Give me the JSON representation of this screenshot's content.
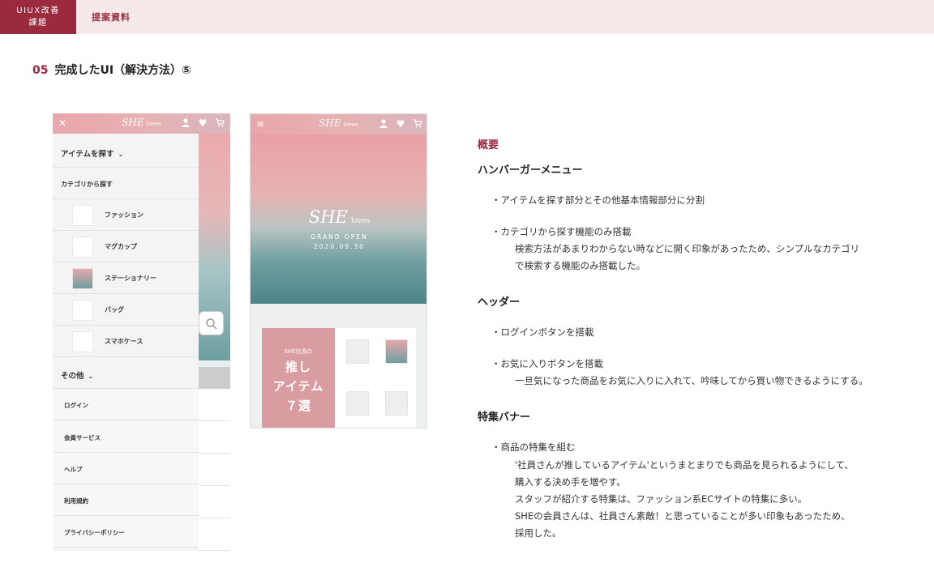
{
  "topbar": {
    "badge_line1": "UIUX改善",
    "badge_line2": "課題",
    "crumb": "提案資料"
  },
  "section": {
    "number": "05",
    "title": "完成したUI（解決方法）⑤"
  },
  "phone_menu": {
    "logo": "SHE",
    "logo_sub": "loves",
    "drawer": {
      "items_heading": "アイテムを探す",
      "category_heading": "カテゴリから探す",
      "categories": [
        "ファッション",
        "マグカップ",
        "ステーショナリー",
        "バッグ",
        "スマホケース"
      ],
      "other_heading": "その他",
      "other_links": [
        "ログイン",
        "会員サービス",
        "ヘルプ",
        "利用規約",
        "プライバシーポリシー"
      ]
    }
  },
  "phone_home": {
    "logo": "SHE",
    "logo_sub": "loves",
    "hero_open": "GRAND OPEN",
    "hero_date": "2020.09.30",
    "banner_sub": "SHE社員の",
    "banner_line1": "推し",
    "banner_line2": "アイテム",
    "banner_line3": "７選"
  },
  "description": {
    "label": "概要",
    "sections": [
      {
        "heading": "ハンバーガーメニュー",
        "bullets": [
          {
            "text": "・アイテムを探す部分とその他基本情報部分に分割",
            "details": []
          },
          {
            "text": "・カテゴリから探す機能のみ搭載",
            "details": [
              "検索方法があまりわからない時などに開く印象があったため、シンプルなカテゴリ",
              "で検索する機能のみ搭載した。"
            ]
          }
        ]
      },
      {
        "heading": "ヘッダー",
        "bullets": [
          {
            "text": "・ログインボタンを搭載",
            "details": []
          },
          {
            "text": "・お気に入りボタンを搭載",
            "details": [
              "一旦気になった商品をお気に入りに入れて、吟味してから買い物できるようにする。"
            ]
          }
        ]
      },
      {
        "heading": "特集バナー",
        "bullets": [
          {
            "text": "・商品の特集を組む",
            "details": [
              "'社員さんが推しているアイテム'というまとまりでも商品を見られるようにして、",
              "購入する決め手を増やす。",
              "スタッフが紹介する特集は、ファッション系ECサイトの特集に多い。",
              "SHEの会員さんは、社員さん素敵！と思っていることが多い印象もあったため、",
              "採用した。"
            ]
          }
        ]
      }
    ]
  }
}
